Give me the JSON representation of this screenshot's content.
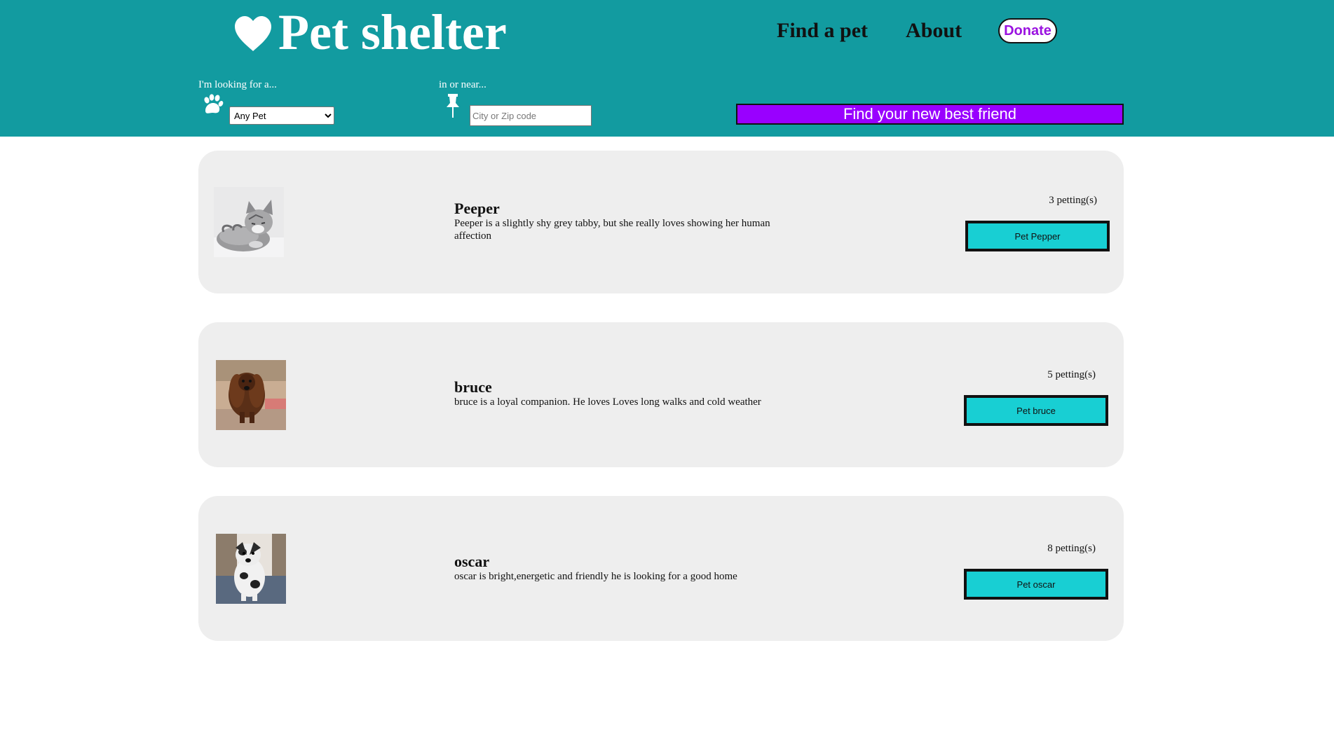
{
  "brand": {
    "title": "Pet shelter",
    "icon": "heart-icon",
    "text_color": "#ffffff"
  },
  "header": {
    "background": "#129ba0"
  },
  "nav": {
    "find_label": "Find a pet",
    "about_label": "About",
    "donate_label": "Donate",
    "donate_color": "#9a12e0"
  },
  "search": {
    "pet_label": "I'm looking for a...",
    "pet_icon": "paw-icon",
    "pet_selected": "Any Pet",
    "location_label": "in or near...",
    "location_icon": "pin-icon",
    "location_placeholder": "City or Zip code",
    "location_value": "",
    "submit_label": "Find your new best friend",
    "submit_color": "#9900ff"
  },
  "pets": [
    {
      "name": "Peeper",
      "description": "Peeper is a slightly shy grey tabby, but she really loves showing her human affection",
      "petting_count": "3 petting(s)",
      "button_label": "Pet Pepper"
    },
    {
      "name": "bruce",
      "description": "bruce is a loyal companion. He loves Loves long walks and cold weather",
      "petting_count": "5 petting(s)",
      "button_label": "Pet bruce"
    },
    {
      "name": "oscar",
      "description": "oscar is bright,energetic and friendly he is looking for a good home",
      "petting_count": "8 petting(s)",
      "button_label": "Pet oscar"
    }
  ],
  "colors": {
    "card_background": "#eeeeee",
    "pet_button": "#18cfd3"
  }
}
